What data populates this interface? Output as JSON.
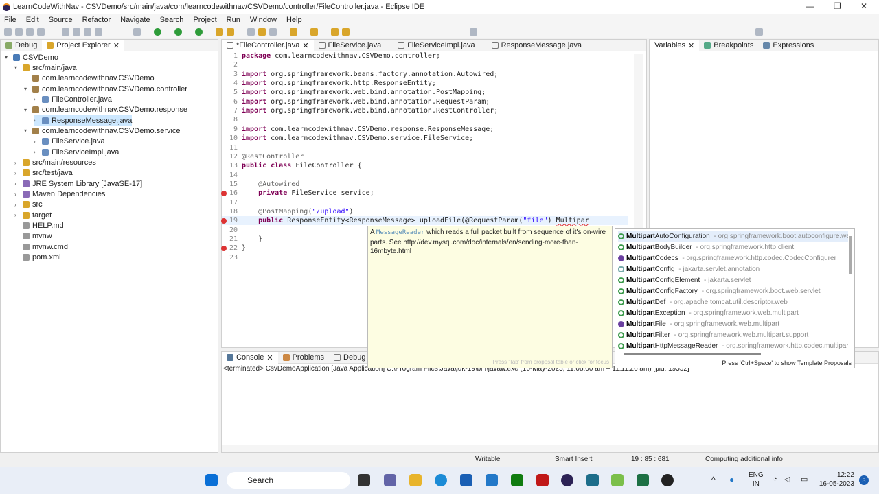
{
  "window": {
    "title": "LearnCodeWithNav - CSVDemo/src/main/java/com/learncodewithnav/CSVDemo/controller/FileController.java - Eclipse IDE"
  },
  "menu": [
    "File",
    "Edit",
    "Source",
    "Refactor",
    "Navigate",
    "Search",
    "Project",
    "Run",
    "Window",
    "Help"
  ],
  "left_tabs": [
    "Debug",
    "Project Explorer"
  ],
  "tree": [
    {
      "label": "CSVDemo",
      "depth": 0,
      "tw": "▾",
      "icon": "project"
    },
    {
      "label": "src/main/java",
      "depth": 1,
      "tw": "▾",
      "icon": "folder"
    },
    {
      "label": "com.learncodewithnav.CSVDemo",
      "depth": 2,
      "tw": "",
      "icon": "package"
    },
    {
      "label": "com.learncodewithnav.CSVDemo.controller",
      "depth": 2,
      "tw": "▾",
      "icon": "package"
    },
    {
      "label": "FileController.java",
      "depth": 3,
      "tw": "›",
      "icon": "java"
    },
    {
      "label": "com.learncodewithnav.CSVDemo.response",
      "depth": 2,
      "tw": "▾",
      "icon": "package"
    },
    {
      "label": "ResponseMessage.java",
      "depth": 3,
      "tw": "›",
      "icon": "java",
      "selected": true
    },
    {
      "label": "com.learncodewithnav.CSVDemo.service",
      "depth": 2,
      "tw": "▾",
      "icon": "package"
    },
    {
      "label": "FileService.java",
      "depth": 3,
      "tw": "›",
      "icon": "java"
    },
    {
      "label": "FileServiceImpl.java",
      "depth": 3,
      "tw": "›",
      "icon": "java"
    },
    {
      "label": "src/main/resources",
      "depth": 1,
      "tw": "›",
      "icon": "folder"
    },
    {
      "label": "src/test/java",
      "depth": 1,
      "tw": "›",
      "icon": "folder"
    },
    {
      "label": "JRE System Library [JavaSE-17]",
      "depth": 1,
      "tw": "›",
      "icon": "library"
    },
    {
      "label": "Maven Dependencies",
      "depth": 1,
      "tw": "›",
      "icon": "library"
    },
    {
      "label": "src",
      "depth": 1,
      "tw": "›",
      "icon": "folder"
    },
    {
      "label": "target",
      "depth": 1,
      "tw": "›",
      "icon": "folder"
    },
    {
      "label": "HELP.md",
      "depth": 1,
      "tw": "",
      "icon": "file"
    },
    {
      "label": "mvnw",
      "depth": 1,
      "tw": "",
      "icon": "file"
    },
    {
      "label": "mvnw.cmd",
      "depth": 1,
      "tw": "",
      "icon": "file"
    },
    {
      "label": "pom.xml",
      "depth": 1,
      "tw": "",
      "icon": "file"
    }
  ],
  "editor_tabs": [
    "*FileController.java",
    "FileService.java",
    "FileServiceImpl.java",
    "ResponseMessage.java"
  ],
  "code": [
    [
      [
        "package ",
        "k"
      ],
      [
        "com.learncodewithnav.CSVDemo.controller;",
        ""
      ]
    ],
    [],
    [
      [
        "import ",
        "k"
      ],
      [
        "org.springframework.beans.factory.annotation.Autowired;",
        ""
      ]
    ],
    [
      [
        "import ",
        "k"
      ],
      [
        "org.springframework.http.ResponseEntity;",
        ""
      ]
    ],
    [
      [
        "import ",
        "k"
      ],
      [
        "org.springframework.web.bind.annotation.PostMapping;",
        ""
      ]
    ],
    [
      [
        "import ",
        "k"
      ],
      [
        "org.springframework.web.bind.annotation.RequestParam;",
        ""
      ]
    ],
    [
      [
        "import ",
        "k"
      ],
      [
        "org.springframework.web.bind.annotation.RestController;",
        ""
      ]
    ],
    [],
    [
      [
        "import ",
        "k"
      ],
      [
        "com.learncodewithnav.CSVDemo.response.ResponseMessage;",
        ""
      ]
    ],
    [
      [
        "import ",
        "k"
      ],
      [
        "com.learncodewithnav.CSVDemo.service.FileService;",
        ""
      ]
    ],
    [],
    [
      [
        "@RestController",
        "a"
      ]
    ],
    [
      [
        "public class ",
        "k"
      ],
      [
        "FileController {",
        ""
      ]
    ],
    [],
    [
      [
        "    @Autowired",
        "a"
      ]
    ],
    [
      [
        "    private ",
        "k"
      ],
      [
        "FileService service;",
        ""
      ]
    ],
    [],
    [
      [
        "    @PostMapping(",
        "a"
      ],
      [
        "\"/upload\"",
        "s"
      ],
      [
        ")",
        ""
      ]
    ],
    [
      [
        "    public ",
        "k"
      ],
      [
        "ResponseEntity<ResponseMessage> uploadFile(@RequestParam(",
        ""
      ],
      [
        "\"file\"",
        "s"
      ],
      [
        ") ",
        ""
      ],
      [
        "Multipar",
        "err"
      ]
    ],
    [],
    [
      [
        "    }",
        ""
      ]
    ],
    [
      [
        "}",
        ""
      ]
    ],
    []
  ],
  "doc_popup": {
    "link": "MessageReader",
    "text": " which reads a full packet built from sequence of it's on-wire parts. See http://dev.mysql.com/doc/internals/en/sending-more-than-16mbyte.html",
    "footer": "Press 'Tab' from proposal table or click for focus"
  },
  "proposals": {
    "typed": "Multipar",
    "items": [
      {
        "rest": "tAutoConfiguration",
        "pkg": "org.springframework.boot.autoconfigure.web",
        "kind": "class"
      },
      {
        "rest": "tBodyBuilder",
        "pkg": "org.springframework.http.client",
        "kind": "class"
      },
      {
        "rest": "tCodecs",
        "pkg": "org.springframework.http.codec.CodecConfigurer",
        "kind": "interface"
      },
      {
        "rest": "tConfig",
        "pkg": "jakarta.servlet.annotation",
        "kind": "annotation"
      },
      {
        "rest": "tConfigElement",
        "pkg": "jakarta.servlet",
        "kind": "class"
      },
      {
        "rest": "tConfigFactory",
        "pkg": "org.springframework.boot.web.servlet",
        "kind": "class"
      },
      {
        "rest": "tDef",
        "pkg": "org.apache.tomcat.util.descriptor.web",
        "kind": "class"
      },
      {
        "rest": "tException",
        "pkg": "org.springframework.web.multipart",
        "kind": "class"
      },
      {
        "rest": "tFile",
        "pkg": "org.springframework.web.multipart",
        "kind": "interface"
      },
      {
        "rest": "tFilter",
        "pkg": "org.springframework.web.multipart.support",
        "kind": "class"
      },
      {
        "rest": "tHttpMessageReader",
        "pkg": "org.springframework.http.codec.multipart",
        "kind": "class"
      }
    ],
    "footer": "Press 'Ctrl+Space' to show Template Proposals"
  },
  "right_tabs": [
    "Variables",
    "Breakpoints",
    "Expressions"
  ],
  "bottom_tabs": [
    "Console",
    "Problems",
    "Debug Shell"
  ],
  "console": {
    "line": "<terminated> CsvDemoApplication [Java Application] C:\\Program Files\\Java\\jdk-19\\bin\\javaw.exe  (16-May-2023, 11:08:00 am – 11:11:26 am) [pid: 19552]"
  },
  "status": {
    "writable": "Writable",
    "insert": "Smart Insert",
    "position": "19 : 85 : 681",
    "info": "Computing additional info"
  },
  "taskbar": {
    "search": "Search",
    "lang1": "ENG",
    "lang2": "IN",
    "time": "12:22",
    "date": "16-05-2023",
    "badge": "3"
  }
}
